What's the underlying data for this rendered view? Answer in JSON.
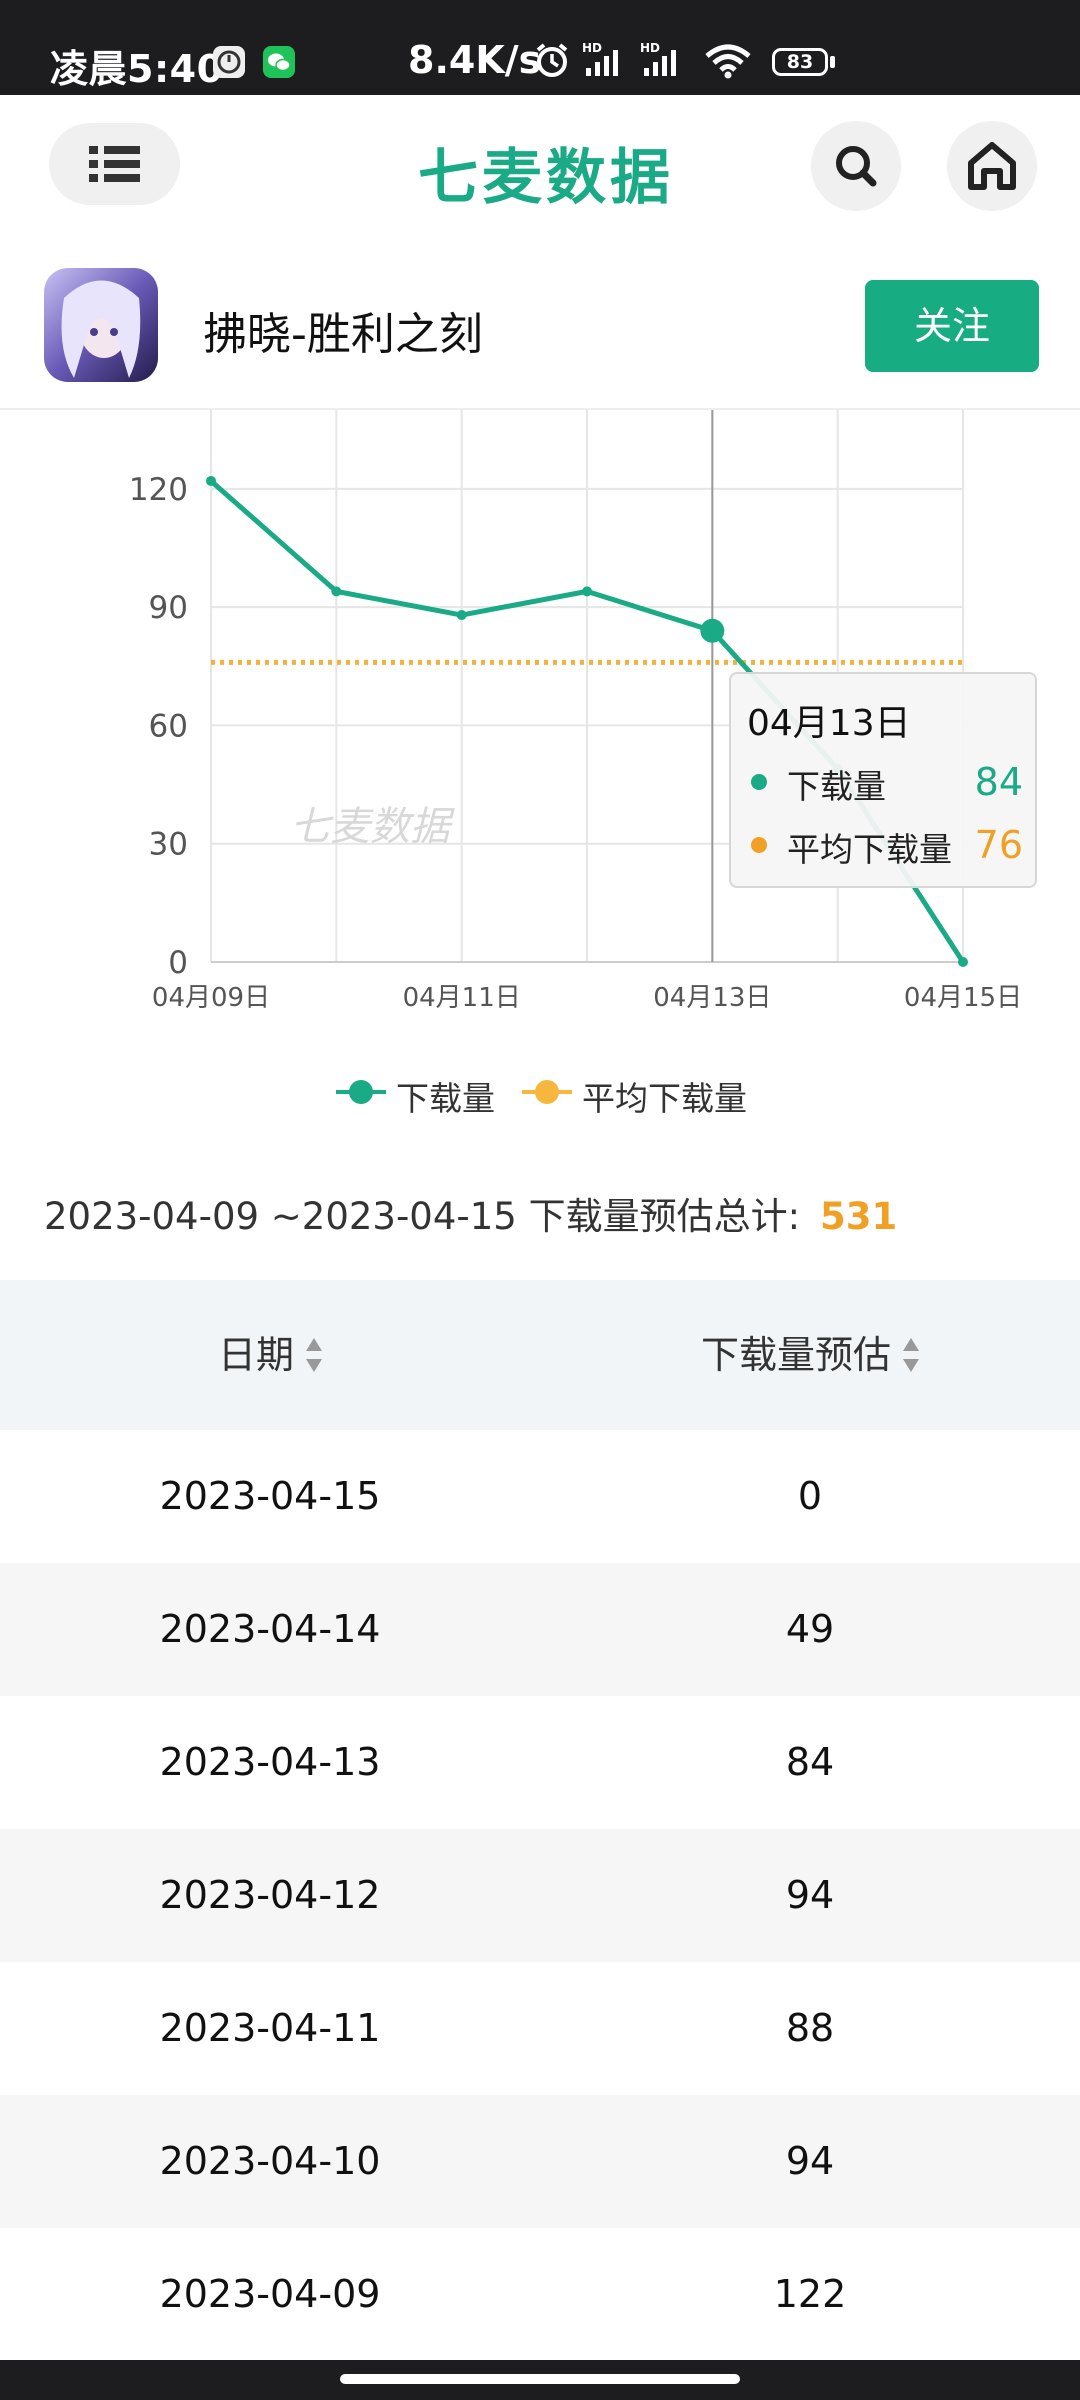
{
  "status_bar": {
    "time": "凌晨5:40",
    "network_speed": "8.4K/s",
    "battery": "83",
    "icons": [
      "clock-app-icon",
      "wechat-icon",
      "alarm-icon",
      "signal-hd-icon",
      "signal-hd-icon",
      "wifi-icon",
      "battery-icon"
    ]
  },
  "header": {
    "logo_text": "七麦数据",
    "menu_icon": "list-menu-icon",
    "search_icon": "search-icon",
    "home_icon": "home-icon"
  },
  "app": {
    "name": "拂晓-胜利之刻",
    "follow_label": "关注"
  },
  "chart_data": {
    "type": "line",
    "x": [
      "04月09日",
      "04月10日",
      "04月11日",
      "04月12日",
      "04月13日",
      "04月14日",
      "04月15日"
    ],
    "x_tick_labels": [
      "04月09日",
      "04月11日",
      "04月13日",
      "04月15日"
    ],
    "y_ticks": [
      "0",
      "30",
      "60",
      "90",
      "120"
    ],
    "ylim": [
      0,
      140
    ],
    "series": [
      {
        "name": "下载量",
        "values": [
          122,
          94,
          88,
          94,
          84,
          49,
          0
        ],
        "color": "#1aaa86"
      },
      {
        "name": "平均下载量",
        "values": [
          76,
          76,
          76,
          76,
          76,
          76,
          76
        ],
        "color": "#f0b43c"
      }
    ],
    "watermark": "七麦数据",
    "grid": true,
    "legend_position": "bottom-center",
    "tooltip": {
      "title": "04月13日",
      "rows": [
        {
          "label": "下载量",
          "value": "84",
          "color": "#1aaa86"
        },
        {
          "label": "平均下载量",
          "value": "76",
          "color": "#f0a024"
        }
      ]
    }
  },
  "summary": {
    "range_text": "2023-04-09 ~2023-04-15 下载量预估总计:",
    "total": "531"
  },
  "table": {
    "headers": [
      "日期",
      "下载量预估"
    ],
    "rows": [
      {
        "date": "2023-04-15",
        "value": "0"
      },
      {
        "date": "2023-04-14",
        "value": "49"
      },
      {
        "date": "2023-04-13",
        "value": "84"
      },
      {
        "date": "2023-04-12",
        "value": "94"
      },
      {
        "date": "2023-04-11",
        "value": "88"
      },
      {
        "date": "2023-04-10",
        "value": "94"
      },
      {
        "date": "2023-04-09",
        "value": "122"
      }
    ]
  }
}
